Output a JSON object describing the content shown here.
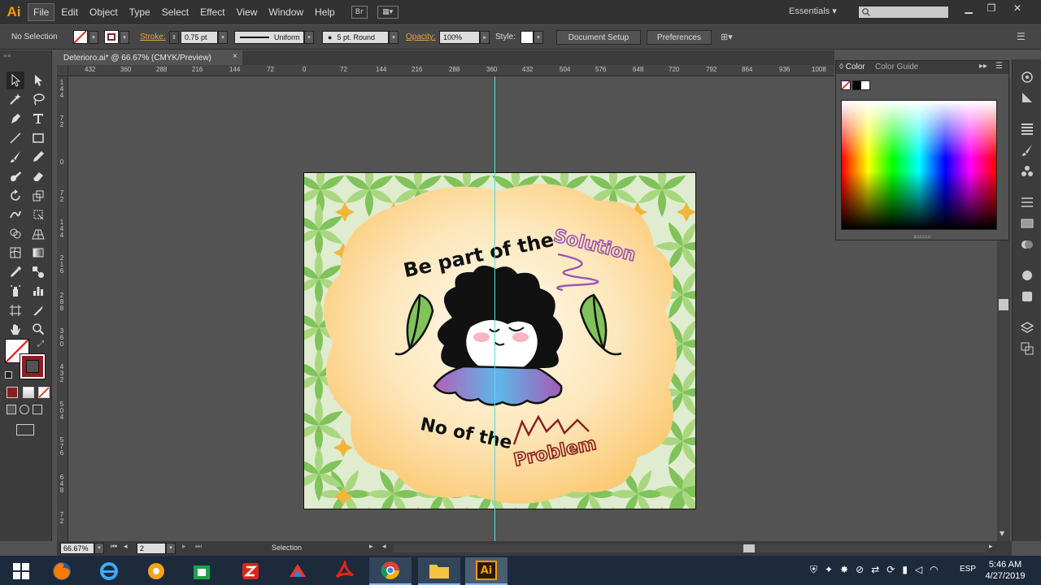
{
  "app": {
    "logo": "Ai"
  },
  "menu": [
    "File",
    "Edit",
    "Object",
    "Type",
    "Select",
    "Effect",
    "View",
    "Window",
    "Help"
  ],
  "workspace": {
    "label": "Essentials ▾"
  },
  "control_bar": {
    "selection": "No Selection",
    "stroke_label": "Stroke:",
    "stroke_weight": "0.75 pt",
    "profile": "Uniform",
    "brush": "5 pt. Round",
    "opacity_label": "Opacity:",
    "opacity": "100%",
    "style_label": "Style:",
    "document_setup": "Document Setup",
    "preferences": "Preferences"
  },
  "document_tab": {
    "title": "Deterioro.ai* @ 66.67% (CMYK/Preview)",
    "close": "×"
  },
  "ruler_top": [
    "432",
    "360",
    "288",
    "216",
    "144",
    "72",
    "0",
    "72",
    "144",
    "216",
    "288",
    "360",
    "432",
    "504",
    "576",
    "648",
    "720",
    "792",
    "864",
    "936",
    "1008"
  ],
  "ruler_left": [
    "1\n4\n4",
    "7\n2",
    "0",
    "7\n2",
    "1\n4\n4",
    "2\n1\n6",
    "2\n8\n8",
    "3\n6\n0",
    "4\n3\n2",
    "5\n0\n4",
    "5\n7\n6",
    "6\n4\n8",
    "7\n2"
  ],
  "artwork": {
    "text_top_a": "Be part of the",
    "text_top_b": "Solution",
    "text_bottom_a": "No of the",
    "text_bottom_b": "Problem",
    "colors": {
      "leaf": "#7fc35a",
      "flower": "#f2b53a",
      "blob": "#fde3b0",
      "solution": "#9b55b5",
      "problem": "#8a1f22"
    }
  },
  "color_panel": {
    "tab_color": "Color",
    "tab_guide": "Color Guide"
  },
  "status_bar": {
    "zoom": "66.67%",
    "artboard": "2",
    "tool": "Selection"
  },
  "taskbar": {
    "lang": "ESP",
    "time": "5:46 AM",
    "date": "4/27/2019"
  }
}
